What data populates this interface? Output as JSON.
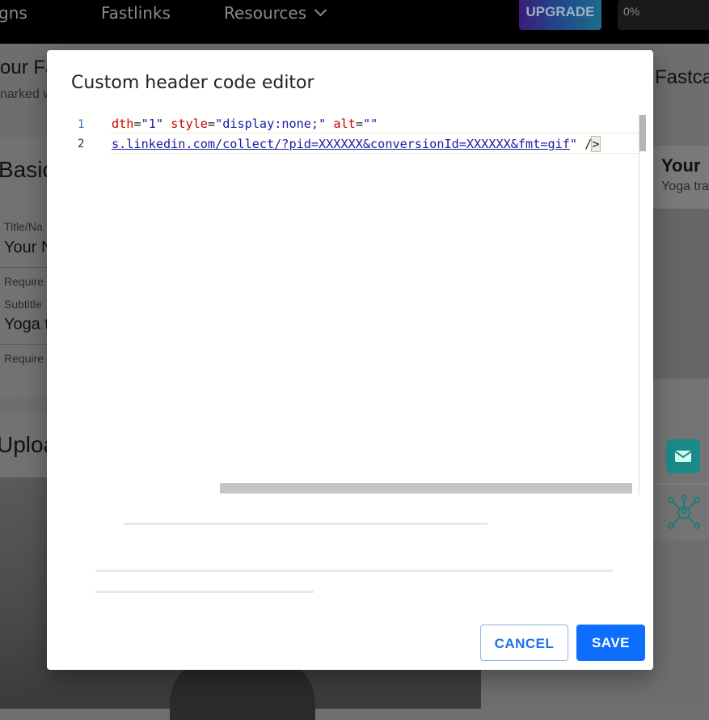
{
  "nav": {
    "items": [
      "gns",
      "Fastlinks",
      "Resources"
    ],
    "upgrade_label": "UPGRADE",
    "progress_label": "0%"
  },
  "background": {
    "left_heading_partial": "our Fa",
    "left_sub_partial": "narked w",
    "section_basic_partial": "Basic",
    "title_label": "Title/Na",
    "title_value": "Your N",
    "required_1": "Require",
    "subtitle_label": "Subtitle",
    "subtitle_value": "Yoga t",
    "required_2": "Require",
    "upload_partial": "Uploa",
    "right_heading_partial": "Fastca",
    "right_card_title": "Your",
    "right_card_sub": "Yoga tra"
  },
  "modal": {
    "title": "Custom header code editor",
    "editor": {
      "line_numbers": [
        "1",
        "2"
      ],
      "line1": [
        {
          "t": "dth",
          "c": "attr"
        },
        {
          "t": "=",
          "c": "eq"
        },
        {
          "t": "\"1\"",
          "c": "str"
        },
        {
          "t": " ",
          "c": "eq"
        },
        {
          "t": "style",
          "c": "attr"
        },
        {
          "t": "=",
          "c": "eq"
        },
        {
          "t": "\"display:none;\"",
          "c": "str"
        },
        {
          "t": " ",
          "c": "eq"
        },
        {
          "t": "alt",
          "c": "attr"
        },
        {
          "t": "=",
          "c": "eq"
        },
        {
          "t": "\"\"",
          "c": "str"
        }
      ],
      "line2_url": "s.linkedin.com/collect/?pid=XXXXXX&conversionId=XXXXXX&fmt=gif",
      "line2_quote": "\"",
      "line2_close": " /",
      "line2_bracket": ">"
    },
    "cancel_label": "CANCEL",
    "save_label": "SAVE"
  },
  "colors": {
    "primary": "#0d6efd",
    "attr": "#cc0000",
    "string": "#1a1aa6"
  },
  "icons": [
    "chevron-down-icon",
    "mail-icon",
    "network-icon"
  ]
}
